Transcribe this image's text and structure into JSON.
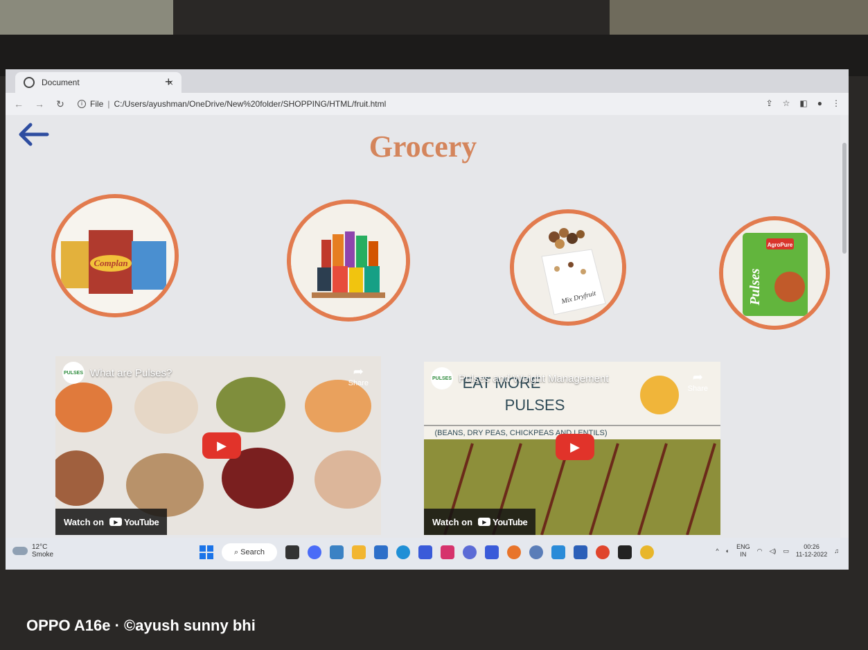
{
  "browser": {
    "tab_title": "Document",
    "tab_close": "×",
    "new_tab": "+",
    "url_prefix": "File",
    "url_sep": "|",
    "url": "C:/Users/ayushman/OneDrive/New%20folder/SHOPPING/HTML/fruit.html"
  },
  "page": {
    "title": "Grocery"
  },
  "videos": [
    {
      "title": "What are Pulses?",
      "share": "Share",
      "watch_on": "Watch on",
      "youtube": "YouTube"
    },
    {
      "title": "Pulses and Weight Management",
      "share": "Share",
      "watch_on": "Watch on",
      "youtube": "YouTube",
      "overlay_line1": "EAT MORE",
      "overlay_line2": "PULSES",
      "overlay_line3": "(BEANS, DRY PEAS, CHICKPEAS AND LENTILS)"
    }
  ],
  "products": [
    {
      "brand_text": "Complan"
    },
    {
      "brand_text": ""
    },
    {
      "brand_text": "Mix Dryfruit"
    },
    {
      "brand_text": "Pulses",
      "brand_sub": "AgroPure"
    }
  ],
  "taskbar": {
    "weather_temp": "12°C",
    "weather_desc": "Smoke",
    "search_label": "Search",
    "lang_top": "ENG",
    "lang_bottom": "IN",
    "time": "00:26",
    "date": "11-12-2022"
  },
  "watermark": "OPPO A16e · ©ayush sunny bhi",
  "colors": {
    "title": "#d4855c",
    "ring": "#e27b4e",
    "yt_play": "#e1332a"
  }
}
